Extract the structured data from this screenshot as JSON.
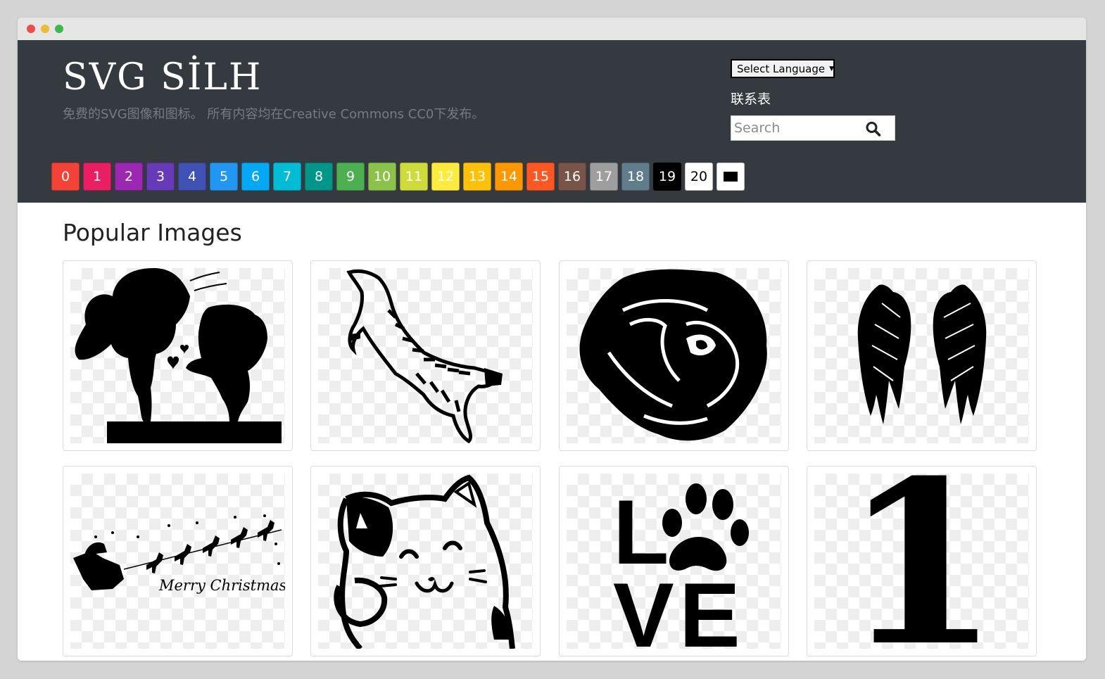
{
  "site": {
    "logo": "SVG SİLH",
    "tagline": "免费的SVG图像和图标。 所有内容均在Creative Commons CC0下发布。"
  },
  "header": {
    "language_select": "Select Language",
    "contact_link": "联系表",
    "search_placeholder": "Search"
  },
  "colors": {
    "header_bg": "#353a40",
    "swatches": [
      {
        "label": "0",
        "color": "#f44336"
      },
      {
        "label": "1",
        "color": "#e91e63"
      },
      {
        "label": "2",
        "color": "#9c27b0"
      },
      {
        "label": "3",
        "color": "#673ab7"
      },
      {
        "label": "4",
        "color": "#3f51b5"
      },
      {
        "label": "5",
        "color": "#2196f3"
      },
      {
        "label": "6",
        "color": "#03a9f4"
      },
      {
        "label": "7",
        "color": "#00bcd4"
      },
      {
        "label": "8",
        "color": "#009688"
      },
      {
        "label": "9",
        "color": "#4caf50"
      },
      {
        "label": "10",
        "color": "#8bc34a"
      },
      {
        "label": "11",
        "color": "#cddc39"
      },
      {
        "label": "12",
        "color": "#ffeb3b"
      },
      {
        "label": "13",
        "color": "#ffc107"
      },
      {
        "label": "14",
        "color": "#ff9800"
      },
      {
        "label": "15",
        "color": "#ff5722"
      },
      {
        "label": "16",
        "color": "#795548"
      },
      {
        "label": "17",
        "color": "#9e9e9e"
      },
      {
        "label": "18",
        "color": "#607d8b"
      },
      {
        "label": "19",
        "color": "#000000"
      },
      {
        "label": "20",
        "color": "#ffffff"
      },
      {
        "label": "",
        "color": "#ffffff",
        "icon": "black-rectangle-icon"
      }
    ]
  },
  "main": {
    "section_title": "Popular Images",
    "images": [
      {
        "name": "couple-silhouette-image"
      },
      {
        "name": "leaping-tiger-image"
      },
      {
        "name": "rose-image"
      },
      {
        "name": "angel-wings-image"
      },
      {
        "name": "santa-sleigh-reindeer-image",
        "caption": "Merry Christmas"
      },
      {
        "name": "lucky-cat-image"
      },
      {
        "name": "love-paw-image",
        "letters": [
          "L",
          "V",
          "E"
        ]
      },
      {
        "name": "number-one-image",
        "text": "1"
      }
    ]
  }
}
